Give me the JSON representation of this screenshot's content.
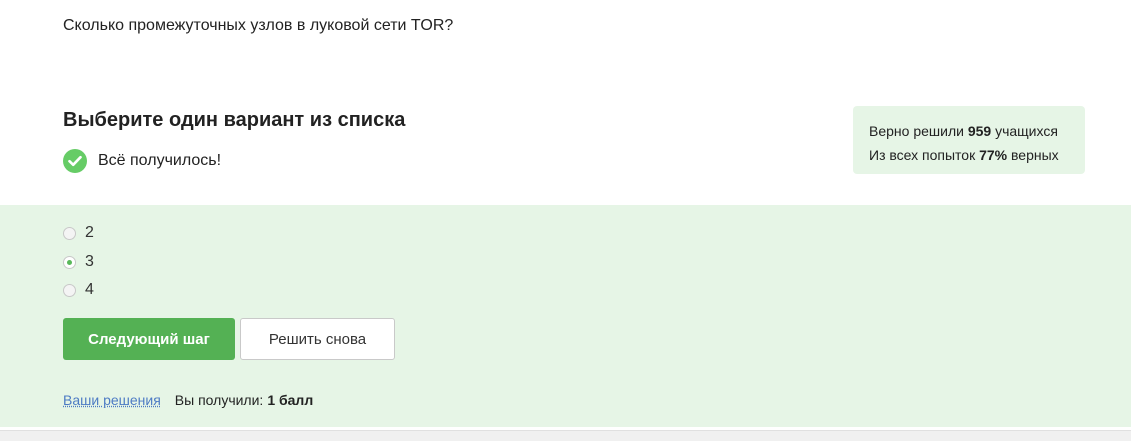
{
  "question": "Сколько промежуточных узлов в луковой сети TOR?",
  "section_title": "Выберите один вариант из списка",
  "result": {
    "message": "Всё получилось!"
  },
  "stats": {
    "solved_prefix": "Верно решили",
    "solved_count": "959",
    "solved_suffix": "учащихся",
    "attempts_prefix": "Из всех попыток",
    "attempts_percent": "77%",
    "attempts_suffix": "верных"
  },
  "options": [
    {
      "label": "2",
      "selected": false
    },
    {
      "label": "3",
      "selected": true
    },
    {
      "label": "4",
      "selected": false
    }
  ],
  "buttons": {
    "next": "Следующий шаг",
    "retry": "Решить снова"
  },
  "footer": {
    "solutions_link": "Ваши решения",
    "score_label": "Вы получили:",
    "score_value": "1 балл"
  },
  "colors": {
    "accent_green": "#54b154",
    "success_bg": "#e6f5e6",
    "link_blue": "#4d7bc4"
  }
}
